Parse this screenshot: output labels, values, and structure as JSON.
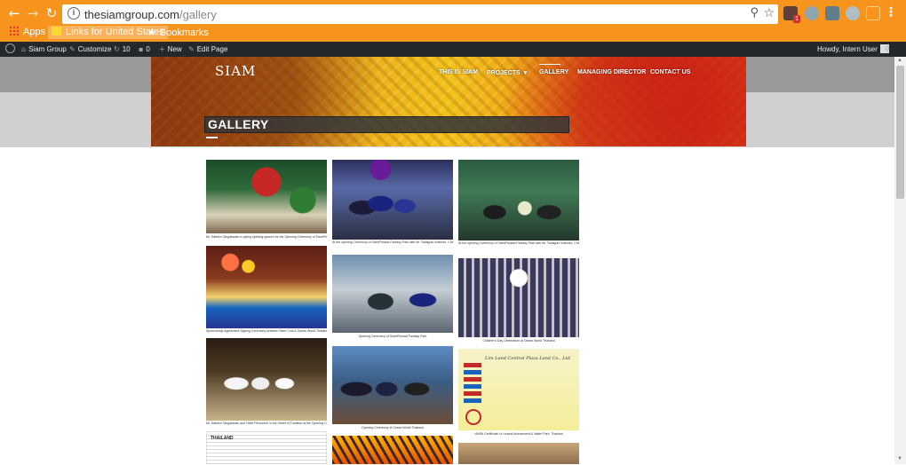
{
  "browser": {
    "back_icon": "arrow-left-icon",
    "forward_icon": "arrow-right-icon",
    "reload_icon": "reload-icon",
    "url_host": "thesiamgroup.com",
    "url_path": "/gallery",
    "zoom_icon": "zoom-icon",
    "bookmark_star_icon": "star-icon",
    "extension_badge": "1",
    "menu_icon": "more-vert-icon"
  },
  "bookmarks_bar": {
    "apps_label": "Apps",
    "folder1_label": "Links for United States",
    "folder2_label": "Bookmarks"
  },
  "admin_bar": {
    "site_name": "Siam Group",
    "customize_label": "Customize",
    "updates_count": "10",
    "comments_count": "0",
    "new_label": "New",
    "edit_label": "Edit Page",
    "howdy_label": "Howdy, Intern User"
  },
  "site": {
    "logo": "SIAM",
    "nav": {
      "this_is_siam": "THIS IS SIAM",
      "projects": "PROJECTS",
      "projects_arrow": "▾",
      "gallery": "GALLERY",
      "managing_director": "MANAGING DIRECTOR",
      "contact_us": "CONTACT US"
    },
    "page_title": "GALLERY"
  },
  "gallery": {
    "captions": [
      "Mr. Sathien Tangatswan is giving opening speech for the Opening Ceremony of SiamPhrasai Fantasy Park",
      "At the opening Ceremony of SiamPhrasai Fantasy Park with Mr. Tadaguni Ishimoto, Chief of Dept. of Criminal Litigation under the Office of the Attorney General of Thailand",
      "At the opening Ceremony of SiamPhrasai Fantasy Park with Mr. Tadaguni Ishimoto, Chief of Dept. of Criminal Litigation under the Office of the Attorney General of Thailand",
      "Sponsorship Agreement Signing Ceremony between Siam Cool & Ocean World Thailand",
      "Opening Ceremony of SiamPhrasai Fantasy Park",
      "Children's Day Celebration at Ocean World Thailand",
      "Mr. Sathien Tangatswan and Hotel Personnel in the Street of Tradition at the Opening Ceremony of Sanook",
      "Opening Ceremony of Ocean World Thailand",
      "IAAPA Certificate of Lorland Amusement & Water Park, Thailand"
    ],
    "cert_title": "Lim Land Central Plaza Land Co., Ltd.",
    "doc_head": "THAILAND"
  },
  "colors": {
    "chrome_orange": "#f7941d",
    "admin_bar": "#23282d",
    "title_bar": "#373737"
  }
}
